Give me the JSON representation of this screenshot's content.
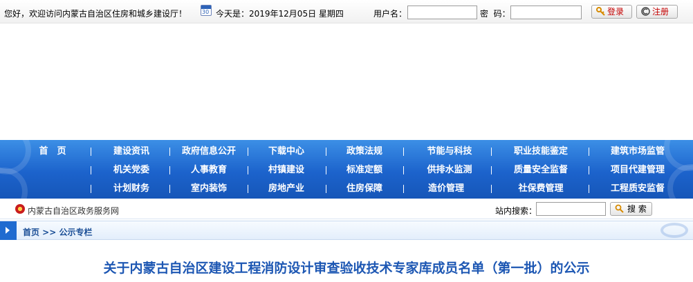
{
  "topbar": {
    "welcome": "您好，欢迎访问内蒙古自治区住房和城乡建设厅！",
    "calendar_icon_text": "30",
    "date": "今天是：2019年12月05日 星期四",
    "username_label": "用户名：",
    "password_label": "密  码：",
    "login_label": "登录",
    "register_label": "注册"
  },
  "nav": {
    "rows": [
      [
        "首　页",
        "建设资讯",
        "政府信息公开",
        "下载中心",
        "政策法规",
        "节能与科技",
        "职业技能鉴定",
        "建筑市场监管"
      ],
      [
        "机关党委",
        "人事教育",
        "村镇建设",
        "标准定额",
        "供排水监测",
        "质量安全监督",
        "项目代建管理"
      ],
      [
        "计划财务",
        "室内装饰",
        "房地产业",
        "住房保障",
        "造价管理",
        "社保费管理",
        "工程质安监督"
      ]
    ]
  },
  "strip": {
    "gov_link": "内蒙古自治区政务服务网",
    "search_label": "站内搜索：",
    "search_button": "搜 索"
  },
  "breadcrumb": "首页 >> 公示专栏",
  "article_title": "关于内蒙古自治区建设工程消防设计审查验收技术专家库成员名单（第一批）的公示",
  "colors": {
    "nav_blue": "#1c63cc",
    "title_blue": "#1d57b3",
    "button_red": "#c40000"
  }
}
